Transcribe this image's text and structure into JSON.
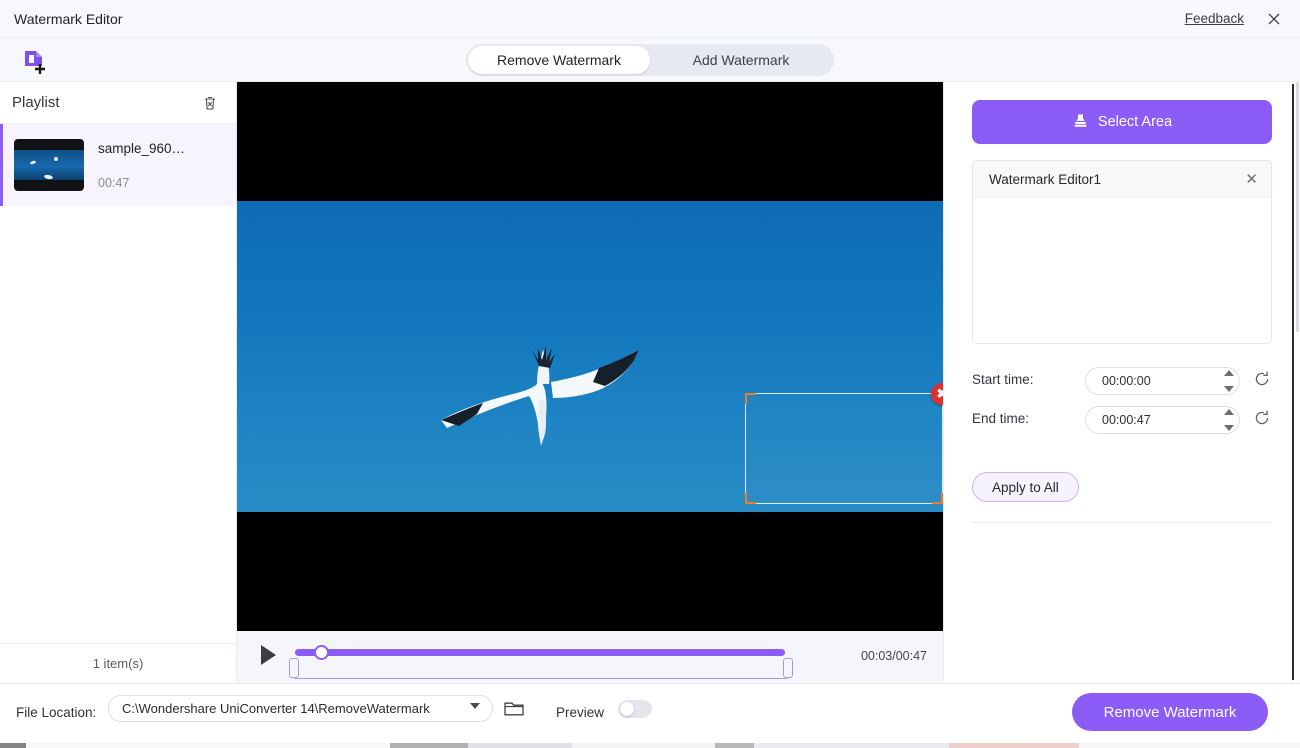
{
  "window": {
    "title": "Watermark Editor",
    "feedback_label": "Feedback",
    "close_icon": "close-icon"
  },
  "toolbar": {
    "add_file_icon": "add-file-icon",
    "tabs": [
      {
        "label": "Remove Watermark",
        "active": true
      },
      {
        "label": "Add Watermark",
        "active": false
      }
    ]
  },
  "playlist": {
    "title": "Playlist",
    "clear_icon": "trash-icon",
    "items": [
      {
        "name": "sample_960…",
        "duration": "00:47",
        "selected": true
      }
    ],
    "footer_count": "1 item(s)"
  },
  "preview": {
    "selection_close_icon": "close-circle-icon",
    "player": {
      "play_icon": "play-icon",
      "timecode": "00:03/00:47",
      "progress_percent": 6
    }
  },
  "right_panel": {
    "select_area_button": "Select Area",
    "select_area_icon": "stamp-icon",
    "watermark_list": [
      {
        "label": "Watermark Editor1",
        "close_icon": "close-icon"
      }
    ],
    "start_time": {
      "label": "Start time:",
      "value": "00:00:00",
      "reset_icon": "reset-icon"
    },
    "end_time": {
      "label": "End time:",
      "value": "00:00:47",
      "reset_icon": "reset-icon"
    },
    "apply_to_all_button": "Apply to All"
  },
  "bottom_bar": {
    "file_location_label": "File Location:",
    "file_location_value": "C:\\Wondershare UniConverter 14\\RemoveWatermark",
    "folder_icon": "folder-icon",
    "dropdown_icon": "chevron-down-icon",
    "preview_label": "Preview",
    "preview_enabled": false,
    "primary_button": "Remove Watermark"
  },
  "colors": {
    "accent": "#8b5cf6",
    "accent_soft": "#f6f2fe",
    "danger": "#e03131",
    "handle": "#f07c2a",
    "chrome": "#f6f8fb"
  }
}
